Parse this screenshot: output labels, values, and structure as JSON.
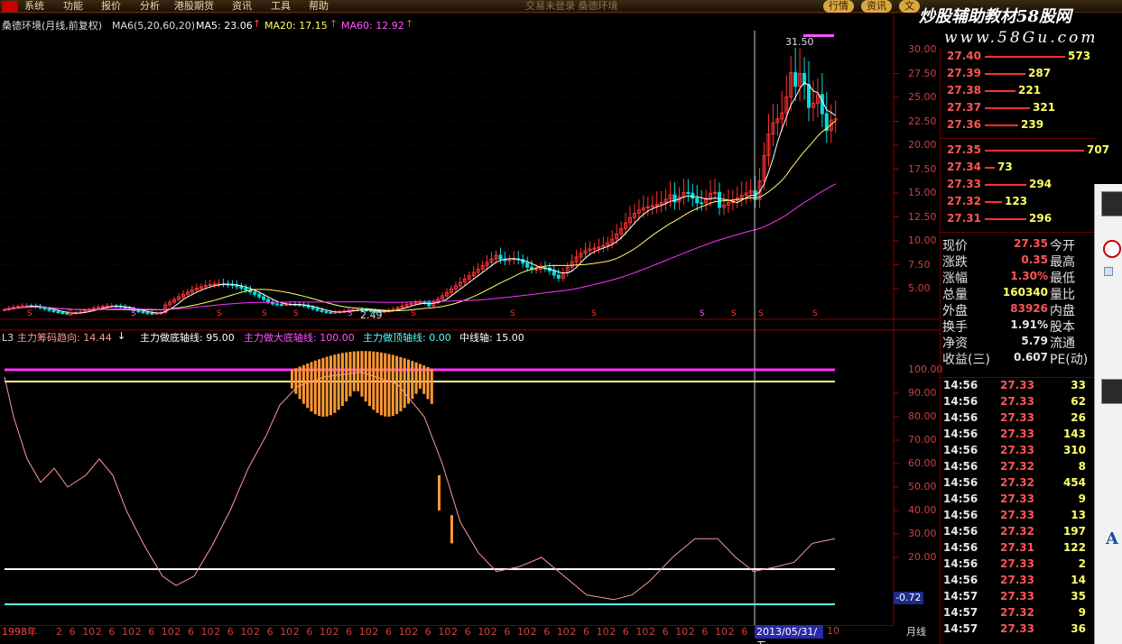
{
  "menu": [
    "系统",
    "功能",
    "报价",
    "分析",
    "港股期货",
    "资讯",
    "工具",
    "帮助"
  ],
  "window_title": "交易未登录     桑德环境",
  "right_tabs": [
    "行情",
    "资讯",
    "文"
  ],
  "watermark": {
    "line1": "炒股辅助教材58股网",
    "line2": "www.58Gu.com"
  },
  "main_header": {
    "name": "桑德环境(月线,前复权)",
    "ma_set": "MA6(5,20,60,20)",
    "ma5": "MA5: 23.06",
    "ma20": "MA20: 17.15",
    "ma60": "MA60: 12.92",
    "arrow": "↑"
  },
  "price_axis": [
    "30.00",
    "27.50",
    "25.00",
    "22.50",
    "20.00",
    "17.50",
    "15.00",
    "12.50",
    "10.00",
    "7.50",
    "5.00"
  ],
  "price_marks": {
    "high": "31.50",
    "low": "2.49"
  },
  "ind_header": {
    "name": "L3",
    "line1": "主力筹码趋向: 14.44",
    "arrow": "↓",
    "line2": "主力做底轴线: 95.00",
    "line3": "主力做大底轴线: 100.00",
    "line4": "主力做顶轴线: 0.00",
    "line5": "中线轴: 15.00"
  },
  "ind_axis": [
    "100.00",
    "90.00",
    "80.00",
    "70.00",
    "60.00",
    "50.00",
    "40.00",
    "30.00",
    "20.00"
  ],
  "ind_current": "-0.72",
  "time_axis": {
    "start": "1998年",
    "ticks": [
      "2",
      "6",
      "10",
      "2",
      "6",
      "10",
      "2",
      "6",
      "10",
      "2",
      "6",
      "10",
      "2",
      "6",
      "10",
      "2",
      "6",
      "10",
      "2",
      "6",
      "10",
      "2",
      "6",
      "10",
      "2",
      "6",
      "10",
      "2",
      "6",
      "10",
      "2",
      "6",
      "10",
      "2",
      "6",
      "10",
      "2",
      "6",
      "10",
      "2",
      "6",
      "10",
      "2",
      "6",
      "10",
      "2",
      "6",
      "10",
      "2",
      "6",
      "10",
      "2",
      "6",
      "10",
      "2"
    ],
    "cursor_date": "2013/05/31/五",
    "end_tick": "10",
    "period": "月线"
  },
  "orderbook_asks": [
    {
      "price": "27.40",
      "vol": "573"
    },
    {
      "price": "27.39",
      "vol": "287"
    },
    {
      "price": "27.38",
      "vol": "221"
    },
    {
      "price": "27.37",
      "vol": "321"
    },
    {
      "price": "27.36",
      "vol": "239"
    }
  ],
  "orderbook_bids": [
    {
      "price": "27.35",
      "vol": "707"
    },
    {
      "price": "27.34",
      "vol": "73"
    },
    {
      "price": "27.33",
      "vol": "294"
    },
    {
      "price": "27.32",
      "vol": "123"
    },
    {
      "price": "27.31",
      "vol": "296"
    }
  ],
  "quote": [
    {
      "k": "现价",
      "v": "27.35",
      "k2": "今开",
      "color": "#ff5555"
    },
    {
      "k": "涨跌",
      "v": "0.35",
      "k2": "最高",
      "color": "#ff5555"
    },
    {
      "k": "涨幅",
      "v": "1.30%",
      "k2": "最低",
      "color": "#ff5555"
    },
    {
      "k": "总量",
      "v": "160340",
      "k2": "量比",
      "color": "#ffff66"
    },
    {
      "k": "外盘",
      "v": "83926",
      "k2": "内盘",
      "color": "#ff5555"
    },
    {
      "k": "换手",
      "v": "1.91%",
      "k2": "股本",
      "color": "#e6e6e6"
    },
    {
      "k": "净资",
      "v": "5.79",
      "k2": "流通",
      "color": "#e6e6e6"
    },
    {
      "k": "收益(三)",
      "v": "0.607",
      "k2": "PE(动)",
      "color": "#e6e6e6"
    }
  ],
  "ticks": [
    {
      "t": "14:56",
      "p": "27.33",
      "v": "33"
    },
    {
      "t": "14:56",
      "p": "27.33",
      "v": "62"
    },
    {
      "t": "14:56",
      "p": "27.33",
      "v": "26"
    },
    {
      "t": "14:56",
      "p": "27.33",
      "v": "143"
    },
    {
      "t": "14:56",
      "p": "27.33",
      "v": "310"
    },
    {
      "t": "14:56",
      "p": "27.32",
      "v": "8"
    },
    {
      "t": "14:56",
      "p": "27.32",
      "v": "454"
    },
    {
      "t": "14:56",
      "p": "27.33",
      "v": "9"
    },
    {
      "t": "14:56",
      "p": "27.33",
      "v": "13"
    },
    {
      "t": "14:56",
      "p": "27.32",
      "v": "197"
    },
    {
      "t": "14:56",
      "p": "27.31",
      "v": "122"
    },
    {
      "t": "14:56",
      "p": "27.33",
      "v": "2"
    },
    {
      "t": "14:56",
      "p": "27.33",
      "v": "14"
    },
    {
      "t": "14:57",
      "p": "27.33",
      "v": "35"
    },
    {
      "t": "14:57",
      "p": "27.32",
      "v": "9"
    },
    {
      "t": "14:57",
      "p": "27.33",
      "v": "36"
    }
  ],
  "colors": {
    "up": "#ff3333",
    "down": "#00e0e0",
    "ma5": "#ffffff",
    "ma20": "#ffff66",
    "ma60": "#ff33ff",
    "ind_line": "#ff9999",
    "bars": "#ff9933"
  }
}
